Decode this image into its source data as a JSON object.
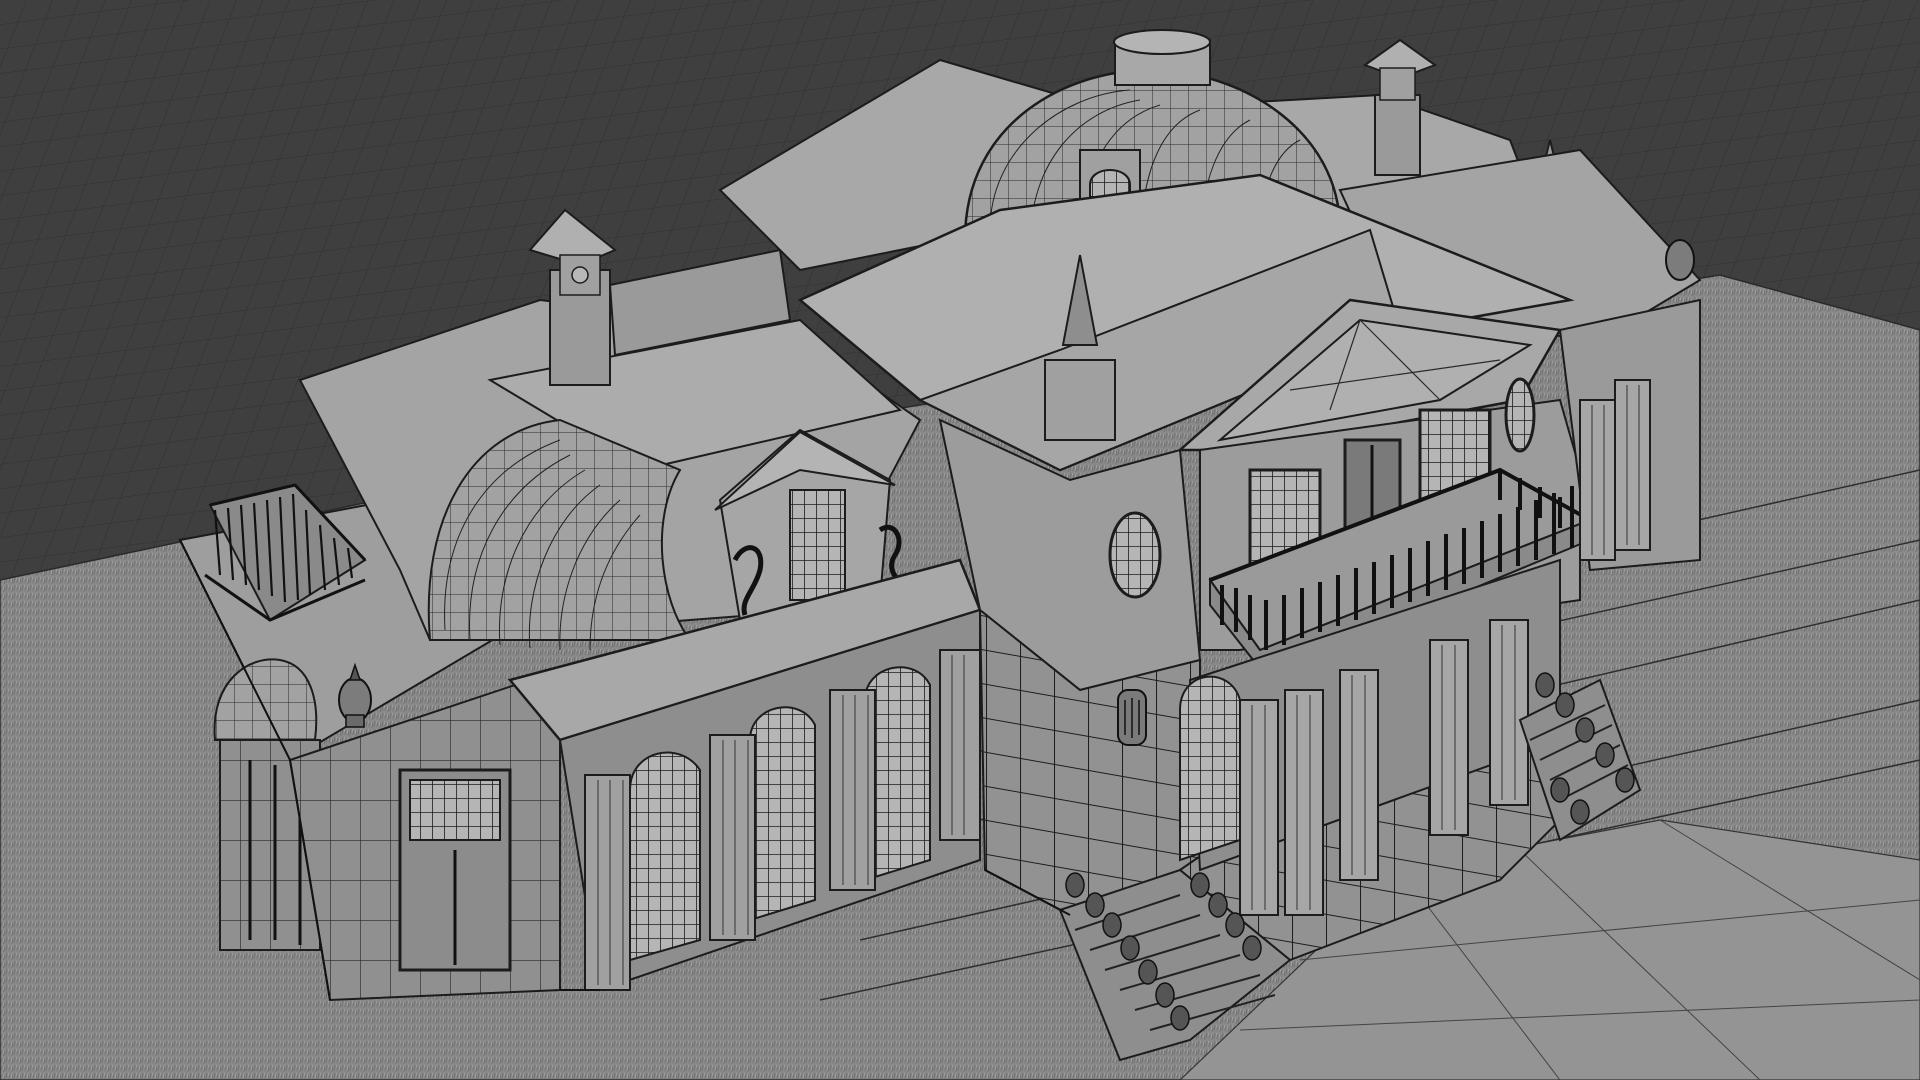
{
  "viewport": {
    "background_color": "#3f3f3f",
    "grid_color": "#2f2f2f",
    "ground_color": "#8a8a8a",
    "model_color": "#9a9a9a",
    "wire_color": "#1c1c1c"
  },
  "scene": {
    "subject": "house-model",
    "render_mode": "solid-with-wireframe"
  }
}
